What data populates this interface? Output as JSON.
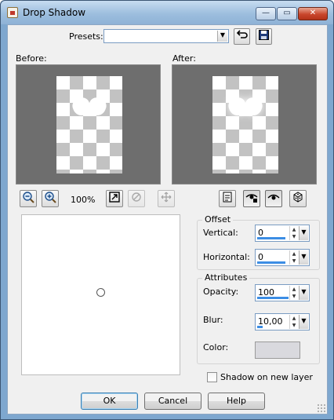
{
  "window": {
    "title": "Drop Shadow",
    "minimize_glyph": "—",
    "maximize_glyph": "▭",
    "close_glyph": "✕"
  },
  "presets": {
    "label": "Presets:",
    "value": ""
  },
  "preview": {
    "before_label": "Before:",
    "after_label": "After:"
  },
  "zoom": {
    "level": "100%"
  },
  "icons": {
    "zoom_out": "zoom-out-icon",
    "zoom_in": "zoom-in-icon",
    "zoom_fit": "fit-window-icon",
    "proof": "proof-icon",
    "pan": "pan-icon",
    "preview_doc": "preview-document-icon",
    "auto_proof": "auto-proof-icon",
    "eye": "eye-icon",
    "randomize": "dice-icon",
    "reset": "reset-icon",
    "save_preset": "save-preset-icon"
  },
  "offset": {
    "group_label": "Offset",
    "vertical_label": "Vertical:",
    "vertical_value": "0",
    "horizontal_label": "Horizontal:",
    "horizontal_value": "0"
  },
  "attributes": {
    "group_label": "Attributes",
    "opacity_label": "Opacity:",
    "opacity_value": "100",
    "blur_label": "Blur:",
    "blur_value": "10,00",
    "color_label": "Color:",
    "color_value": "#d9d9de"
  },
  "shadow_on_new_layer": {
    "label": "Shadow on new layer",
    "checked": false
  },
  "buttons": {
    "ok": "OK",
    "cancel": "Cancel",
    "help": "Help"
  },
  "colors": {
    "title_bar": "#9dbede",
    "accent_bar": "#3c8de4",
    "close_button": "#c9462c"
  }
}
